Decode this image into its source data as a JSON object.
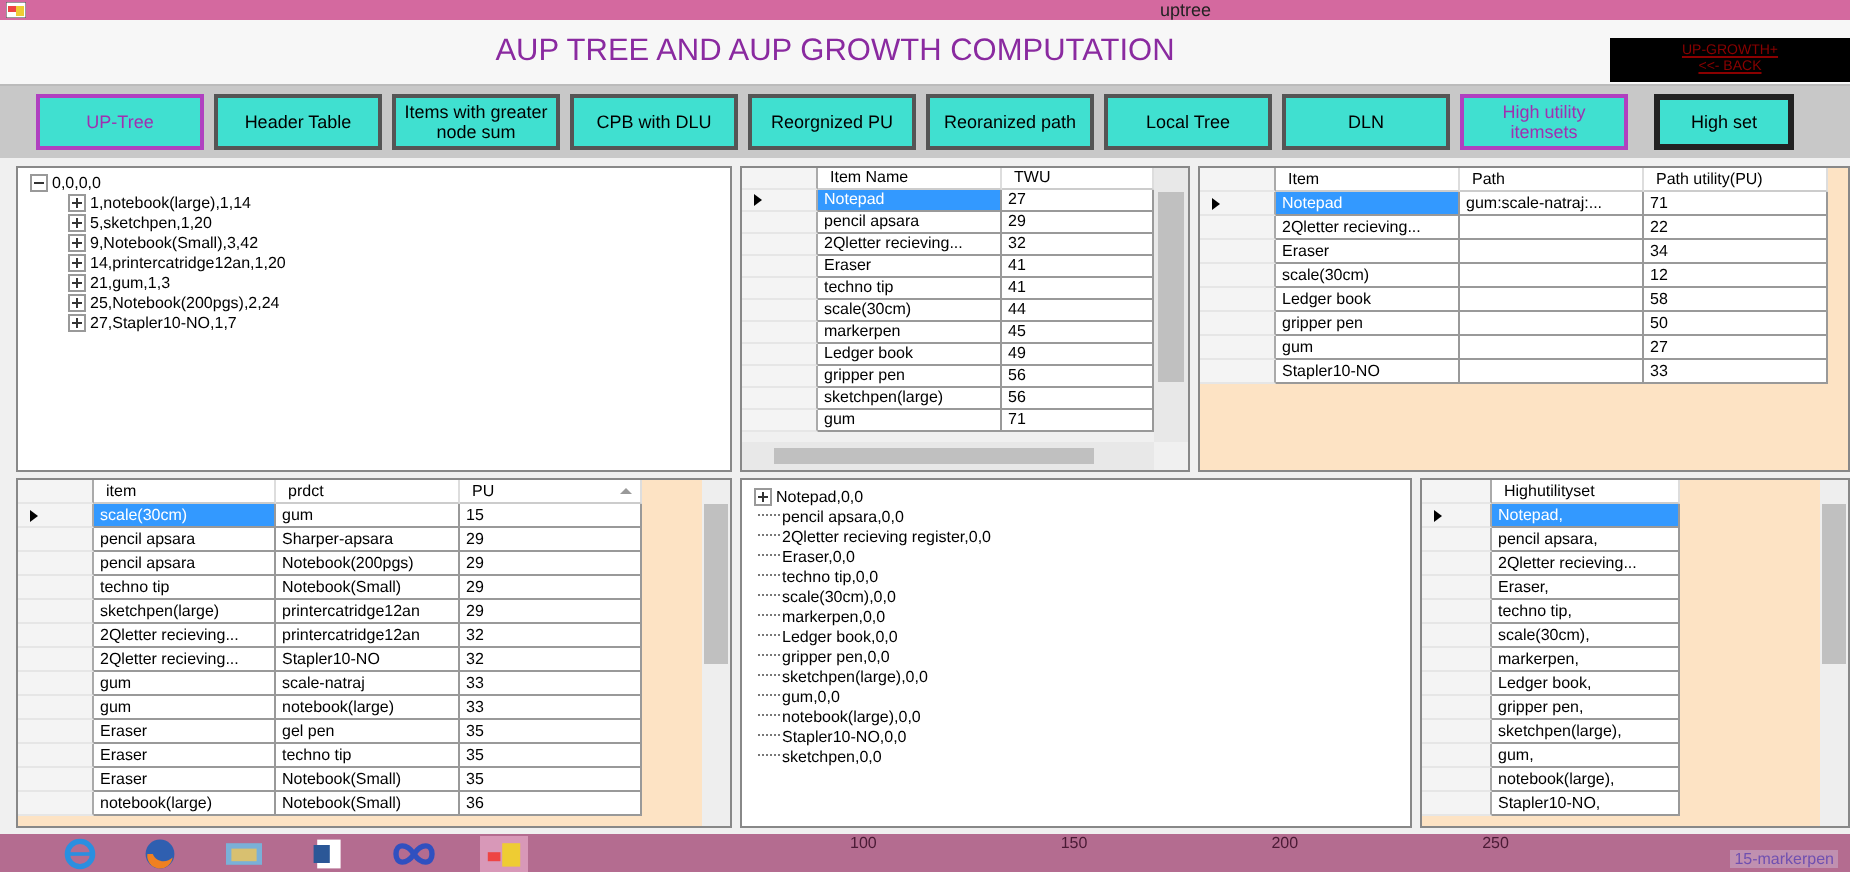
{
  "window": {
    "title": "uptree"
  },
  "heading": "AUP TREE AND AUP GROWTH COMPUTATION",
  "back_box": {
    "lines": [
      "UP-GROWTH+",
      "<<- BACK"
    ]
  },
  "buttons": [
    {
      "label": "UP-Tree",
      "kind": "outlined"
    },
    {
      "label": "Header Table",
      "kind": "plain"
    },
    {
      "label": "Items with greater node sum",
      "kind": "plain"
    },
    {
      "label": "CPB with DLU",
      "kind": "plain"
    },
    {
      "label": "Reorgnized PU",
      "kind": "plain"
    },
    {
      "label": "Reoranized path",
      "kind": "plain"
    },
    {
      "label": "Local Tree",
      "kind": "plain"
    },
    {
      "label": "DLN",
      "kind": "plain"
    },
    {
      "label": "High utility itemsets",
      "kind": "outlined"
    },
    {
      "label": "High set",
      "kind": "framed"
    }
  ],
  "tree": [
    {
      "label": "0,0,0,0",
      "kind": "expanded",
      "children": [
        {
          "label": "1,notebook(large),1,14",
          "kind": "collapsed"
        },
        {
          "label": "5,sketchpen,1,20",
          "kind": "collapsed"
        },
        {
          "label": "9,Notebook(Small),3,42",
          "kind": "collapsed"
        },
        {
          "label": "14,printercatridge12an,1,20",
          "kind": "collapsed"
        },
        {
          "label": "21,gum,1,3",
          "kind": "collapsed"
        },
        {
          "label": "25,Notebook(200pgs),2,24",
          "kind": "collapsed"
        },
        {
          "label": "27,Stapler10-NO,1,7",
          "kind": "collapsed"
        }
      ]
    }
  ],
  "twu_table": {
    "columns": [
      "Item Name",
      "TWU"
    ],
    "rows": [
      {
        "cells": [
          "Notepad",
          "27"
        ],
        "selected": true
      },
      {
        "cells": [
          "pencil apsara",
          "29"
        ],
        "selected": false
      },
      {
        "cells": [
          "2Qletter recieving...",
          "32"
        ],
        "selected": false
      },
      {
        "cells": [
          "Eraser",
          "41"
        ],
        "selected": false
      },
      {
        "cells": [
          "techno tip",
          "41"
        ],
        "selected": false
      },
      {
        "cells": [
          "scale(30cm)",
          "44"
        ],
        "selected": false
      },
      {
        "cells": [
          "markerpen",
          "45"
        ],
        "selected": false
      },
      {
        "cells": [
          "Ledger book",
          "49"
        ],
        "selected": false
      },
      {
        "cells": [
          "gripper pen",
          "56"
        ],
        "selected": false
      },
      {
        "cells": [
          "sketchpen(large)",
          "56"
        ],
        "selected": false
      },
      {
        "cells": [
          "gum",
          "71"
        ],
        "selected": false
      }
    ]
  },
  "path_table": {
    "columns": [
      "Item",
      "Path",
      "Path utility(PU)"
    ],
    "rows": [
      {
        "cells": [
          "Notepad",
          "gum:scale-natraj:...",
          "71"
        ],
        "selected": true
      },
      {
        "cells": [
          "2Qletter recieving...",
          "",
          "22"
        ],
        "selected": false
      },
      {
        "cells": [
          "Eraser",
          "",
          "34"
        ],
        "selected": false
      },
      {
        "cells": [
          "scale(30cm)",
          "",
          "12"
        ],
        "selected": false
      },
      {
        "cells": [
          "Ledger book",
          "",
          "58"
        ],
        "selected": false
      },
      {
        "cells": [
          "gripper pen",
          "",
          "50"
        ],
        "selected": false
      },
      {
        "cells": [
          "gum",
          "",
          "27"
        ],
        "selected": false
      },
      {
        "cells": [
          "Stapler10-NO",
          "",
          "33"
        ],
        "selected": false
      }
    ]
  },
  "pu_table": {
    "columns": [
      "item",
      "prdct",
      "PU"
    ],
    "rows": [
      {
        "cells": [
          "scale(30cm)",
          "gum",
          "15"
        ],
        "selected": true
      },
      {
        "cells": [
          "pencil apsara",
          "Sharper-apsara",
          "29"
        ],
        "selected": false
      },
      {
        "cells": [
          "pencil apsara",
          "Notebook(200pgs)",
          "29"
        ],
        "selected": false
      },
      {
        "cells": [
          "techno tip",
          "Notebook(Small)",
          "29"
        ],
        "selected": false
      },
      {
        "cells": [
          "sketchpen(large)",
          "printercatridge12an",
          "29"
        ],
        "selected": false
      },
      {
        "cells": [
          "2Qletter recieving...",
          "printercatridge12an",
          "32"
        ],
        "selected": false
      },
      {
        "cells": [
          "2Qletter recieving...",
          "Stapler10-NO",
          "32"
        ],
        "selected": false
      },
      {
        "cells": [
          "gum",
          "scale-natraj",
          "33"
        ],
        "selected": false
      },
      {
        "cells": [
          "gum",
          "notebook(large)",
          "33"
        ],
        "selected": false
      },
      {
        "cells": [
          "Eraser",
          "gel pen",
          "35"
        ],
        "selected": false
      },
      {
        "cells": [
          "Eraser",
          "techno tip",
          "35"
        ],
        "selected": false
      },
      {
        "cells": [
          "Eraser",
          "Notebook(Small)",
          "35"
        ],
        "selected": false
      },
      {
        "cells": [
          "notebook(large)",
          "Notebook(Small)",
          "36"
        ],
        "selected": false
      }
    ]
  },
  "local_tree": [
    {
      "label": "Notepad,0,0",
      "kind": "collapsed"
    },
    {
      "label": "pencil apsara,0,0",
      "kind": "leaf"
    },
    {
      "label": "2Qletter recieving register,0,0",
      "kind": "leaf"
    },
    {
      "label": "Eraser,0,0",
      "kind": "leaf"
    },
    {
      "label": "techno tip,0,0",
      "kind": "leaf"
    },
    {
      "label": "scale(30cm),0,0",
      "kind": "leaf"
    },
    {
      "label": "markerpen,0,0",
      "kind": "leaf"
    },
    {
      "label": "Ledger book,0,0",
      "kind": "leaf"
    },
    {
      "label": "gripper pen,0,0",
      "kind": "leaf"
    },
    {
      "label": "sketchpen(large),0,0",
      "kind": "leaf"
    },
    {
      "label": "gum,0,0",
      "kind": "leaf"
    },
    {
      "label": "notebook(large),0,0",
      "kind": "leaf"
    },
    {
      "label": "Stapler10-NO,0,0",
      "kind": "leaf"
    },
    {
      "label": "sketchpen,0,0",
      "kind": "leaf"
    }
  ],
  "hus_table": {
    "columns": [
      "Highutilityset"
    ],
    "rows": [
      {
        "cells": [
          "Notepad,"
        ],
        "selected": true
      },
      {
        "cells": [
          "pencil apsara,"
        ],
        "selected": false
      },
      {
        "cells": [
          "2Qletter recieving..."
        ],
        "selected": false
      },
      {
        "cells": [
          "Eraser,"
        ],
        "selected": false
      },
      {
        "cells": [
          "techno tip,"
        ],
        "selected": false
      },
      {
        "cells": [
          "scale(30cm),"
        ],
        "selected": false
      },
      {
        "cells": [
          "markerpen,"
        ],
        "selected": false
      },
      {
        "cells": [
          "Ledger book,"
        ],
        "selected": false
      },
      {
        "cells": [
          "gripper pen,"
        ],
        "selected": false
      },
      {
        "cells": [
          "sketchpen(large),"
        ],
        "selected": false
      },
      {
        "cells": [
          "gum,"
        ],
        "selected": false
      },
      {
        "cells": [
          "notebook(large),"
        ],
        "selected": false
      },
      {
        "cells": [
          "Stapler10-NO,"
        ],
        "selected": false
      }
    ]
  },
  "taskbar": {
    "background_labels": [
      "100",
      "150",
      "200",
      "250"
    ],
    "background_legend": "15-markerpen"
  }
}
